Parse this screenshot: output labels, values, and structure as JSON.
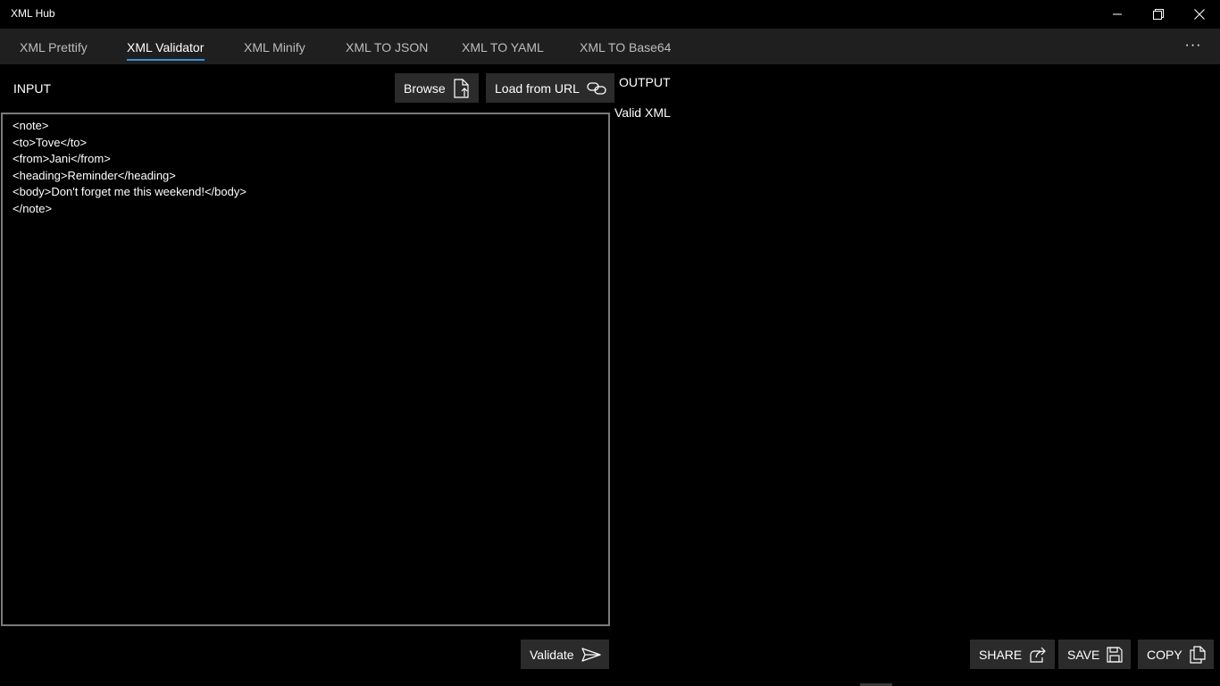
{
  "window": {
    "title": "XML Hub"
  },
  "tabs": [
    {
      "label": "XML Prettify",
      "active": false
    },
    {
      "label": "XML Validator",
      "active": true
    },
    {
      "label": "XML Minify",
      "active": false
    },
    {
      "label": "XML TO JSON",
      "active": false
    },
    {
      "label": "XML TO YAML",
      "active": false
    },
    {
      "label": "XML TO Base64",
      "active": false
    }
  ],
  "more_label": "···",
  "input": {
    "label": "INPUT",
    "browse_label": "Browse",
    "load_url_label": "Load from URL",
    "value": "<note>\n<to>Tove</to>\n<from>Jani</from>\n<heading>Reminder</heading>\n<body>Don't forget me this weekend!</body>\n</note>",
    "validate_label": "Validate"
  },
  "output": {
    "label": "OUTPUT",
    "result": "Valid XML",
    "share_label": "SHARE",
    "save_label": "SAVE",
    "copy_label": "COPY"
  },
  "colors": {
    "background": "#000000",
    "tabbar": "#1f1f1f",
    "button": "#2b2b2b",
    "accent": "#3a8fd6",
    "border": "#7a7a7a"
  },
  "icons": {
    "minimize": "minimize-icon",
    "restore": "restore-icon",
    "close": "close-icon",
    "browse": "file-upload-icon",
    "load_url": "link-icon",
    "validate": "send-icon",
    "share": "share-icon",
    "save": "save-icon",
    "copy": "copy-icon"
  }
}
